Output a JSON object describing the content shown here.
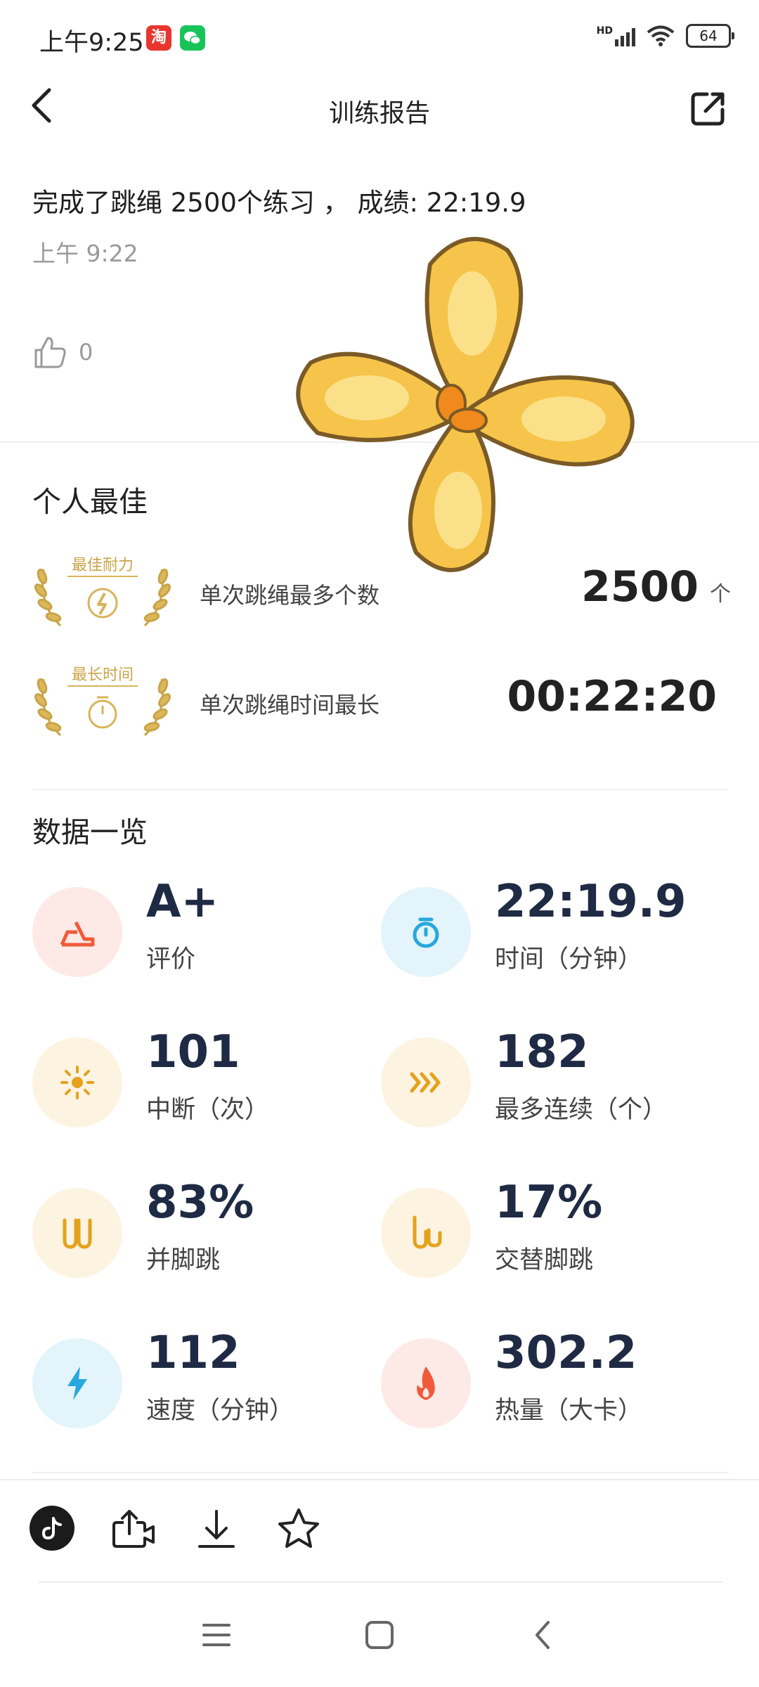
{
  "status_bar": {
    "time": "上午9:25",
    "apps": [
      {
        "name": "taobao",
        "glyph": "淘",
        "color": "#e8352d"
      },
      {
        "name": "wechat",
        "glyph": "✉",
        "color": "#18c45a"
      }
    ],
    "network": "HD",
    "battery": "64"
  },
  "header": {
    "title": "训练报告"
  },
  "summary": {
    "text": "完成了跳绳 2500个练习 ， 成绩: 22:19.9",
    "time": "上午 9:22",
    "likes": "0"
  },
  "personal_best": {
    "title": "个人最佳",
    "items": [
      {
        "badge": "最佳耐力",
        "label": "单次跳绳最多个数",
        "value": "2500",
        "unit": "个",
        "badge_icon": "lightning-icon"
      },
      {
        "badge": "最长时间",
        "label": "单次跳绳时间最长",
        "value": "00:22:20",
        "unit": "",
        "badge_icon": "stopwatch-icon"
      }
    ]
  },
  "overview": {
    "title": "数据一览",
    "stats": [
      {
        "value": "A+",
        "label": "评价",
        "icon": "rating-icon",
        "bg": "#fdeae6",
        "color": "#f05a3a"
      },
      {
        "value": "22:19.9",
        "label": "时间（分钟）",
        "icon": "timer-icon",
        "bg": "#e3f4fb",
        "color": "#27a8de"
      },
      {
        "value": "101",
        "label": "中断（次）",
        "icon": "sun-icon",
        "bg": "#fdf3e1",
        "color": "#e4a21c"
      },
      {
        "value": "182",
        "label": "最多连续（个）",
        "icon": "chevrons-icon",
        "bg": "#fdf3e1",
        "color": "#e4a21c"
      },
      {
        "value": "83%",
        "label": "并脚跳",
        "icon": "feet-together-icon",
        "bg": "#fdf3e1",
        "color": "#e4a21c"
      },
      {
        "value": "17%",
        "label": "交替脚跳",
        "icon": "feet-alternate-icon",
        "bg": "#fdf3e1",
        "color": "#e4a21c"
      },
      {
        "value": "112",
        "label": "速度（分钟）",
        "icon": "bolt-icon",
        "bg": "#e3f4fb",
        "color": "#27a8de"
      },
      {
        "value": "302.2",
        "label": "热量（大卡）",
        "icon": "flame-icon",
        "bg": "#fdeae6",
        "color": "#f05a3a"
      }
    ]
  },
  "bottom_bar": {
    "icons": [
      "tiktok-icon",
      "export-video-icon",
      "download-icon",
      "star-icon"
    ]
  }
}
